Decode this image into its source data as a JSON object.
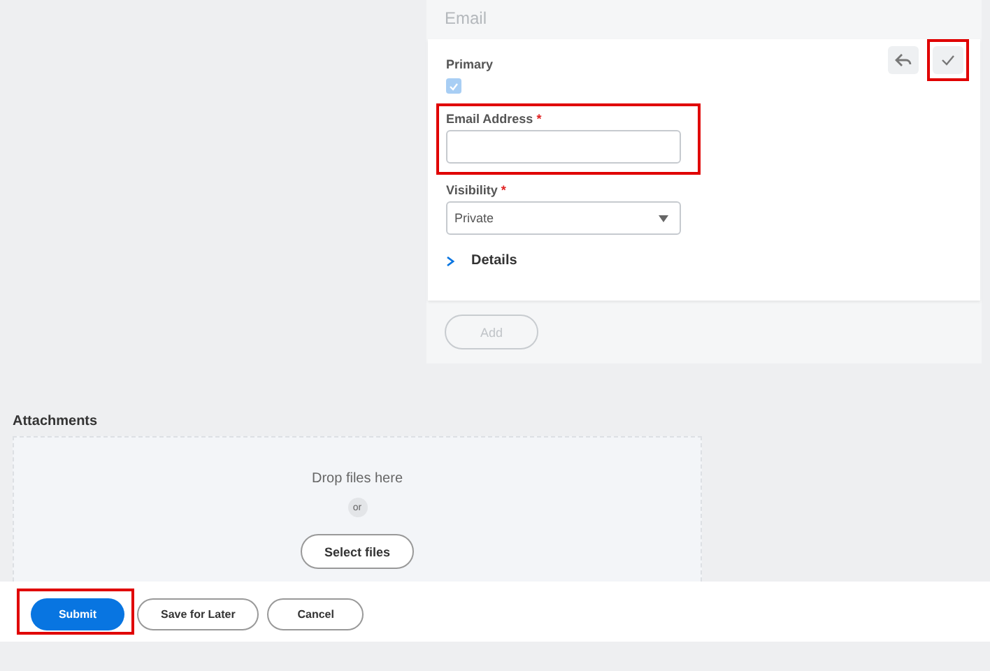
{
  "email_panel": {
    "title": "Email",
    "actions": [
      {
        "kind": "undo",
        "highlighted": false
      },
      {
        "kind": "confirm",
        "highlighted": true
      }
    ],
    "primary": {
      "label": "Primary",
      "checked": true,
      "disabled": true
    },
    "email_address": {
      "label": "Email Address",
      "required_mark": "*",
      "highlighted": true
    },
    "visibility": {
      "label": "Visibility",
      "required_mark": "*",
      "value": "Private"
    },
    "details": {
      "label": "Details",
      "expanded": false
    },
    "add_button": {
      "label": "Add",
      "disabled": true
    }
  },
  "attachments": {
    "title": "Attachments",
    "drop_text": "Drop files here",
    "or_text": "or",
    "select_button": "Select files"
  },
  "footer": {
    "buttons": [
      {
        "label": "Submit",
        "kind": "primary",
        "highlighted": true
      },
      {
        "label": "Save for Later",
        "kind": "secondary",
        "highlighted": false
      },
      {
        "label": "Cancel",
        "kind": "secondary",
        "highlighted": false
      }
    ]
  }
}
